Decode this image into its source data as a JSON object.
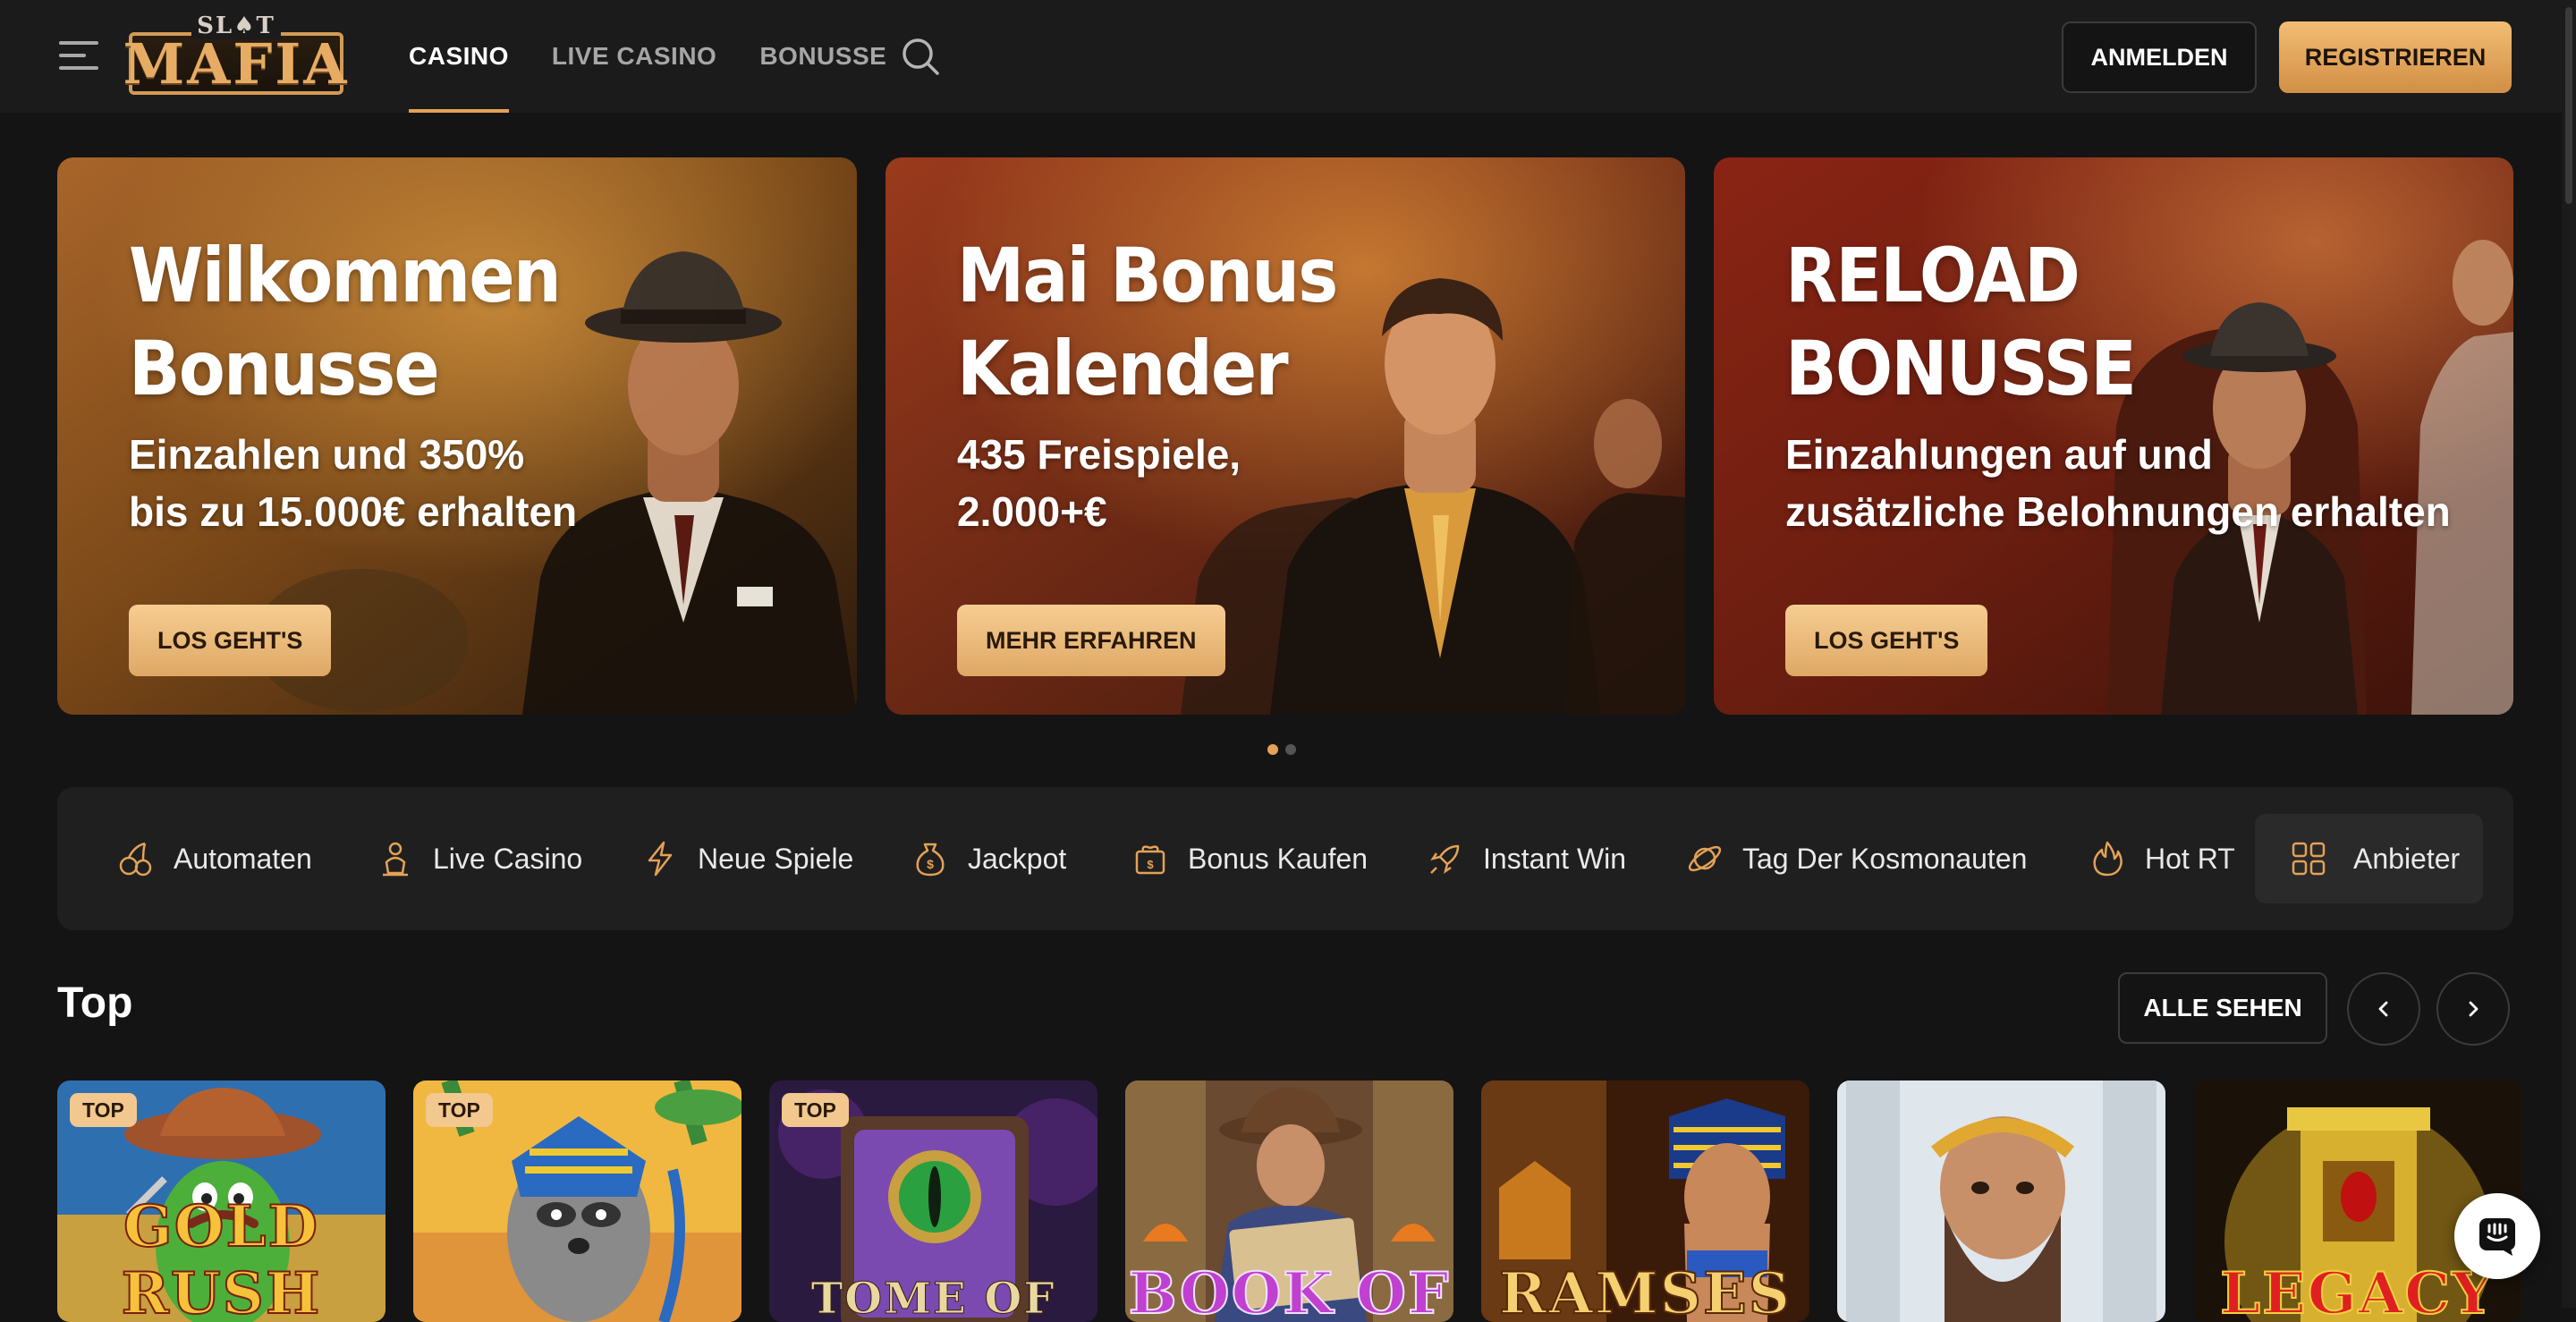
{
  "header": {
    "logo_small": "SL♠T",
    "logo_main": "MAFIA",
    "nav": [
      {
        "label": "CASINO",
        "active": true
      },
      {
        "label": "LIVE CASINO",
        "active": false
      },
      {
        "label": "BONUSSE",
        "active": false
      }
    ],
    "login_label": "ANMELDEN",
    "register_label": "REGISTRIEREN"
  },
  "banners": [
    {
      "title": "Wilkommen\nBonusse",
      "subtitle": "Einzahlen und 350%\nbis zu 15.000€ erhalten",
      "button": "LOS GEHT'S"
    },
    {
      "title": "Mai Bonus\nKalender",
      "subtitle": "435 Freispiele,\n2.000+€",
      "button": "MEHR ERFAHREN"
    },
    {
      "title": "RELOAD\nBONUSSE",
      "subtitle": "Einzahlungen auf und\nzusätzliche Belohnungen erhalten",
      "button": "LOS GEHT'S"
    }
  ],
  "carousel": {
    "pages": 2,
    "active_page": 1
  },
  "categories": [
    {
      "label": "Automaten",
      "icon": "cherries-icon"
    },
    {
      "label": "Live Casino",
      "icon": "dealer-icon"
    },
    {
      "label": "Neue Spiele",
      "icon": "lightning-icon"
    },
    {
      "label": "Jackpot",
      "icon": "money-bag-icon"
    },
    {
      "label": "Bonus Kaufen",
      "icon": "gift-money-icon"
    },
    {
      "label": "Instant Win",
      "icon": "rocket-icon"
    },
    {
      "label": "Tag Der Kosmonauten",
      "icon": "planet-icon"
    },
    {
      "label": "Hot RT",
      "icon": "flame-icon"
    }
  ],
  "providers_label": "Anbieter",
  "top_section": {
    "title": "Top",
    "see_all_label": "ALLE SEHEN",
    "badge_label": "TOP",
    "games": [
      {
        "title": "GOLD RUSH",
        "badge": true
      },
      {
        "title": "",
        "badge": true
      },
      {
        "title": "TOME OF",
        "badge": true
      },
      {
        "title": "BOOK OF",
        "badge": false
      },
      {
        "title": "RAMSES",
        "badge": false
      },
      {
        "title": "",
        "badge": false
      },
      {
        "title": "LEGACY",
        "badge": false
      }
    ]
  },
  "colors": {
    "accent": "#e3a257",
    "background": "#141414",
    "header": "#1b1b1b",
    "card": "#1f1f1f"
  }
}
